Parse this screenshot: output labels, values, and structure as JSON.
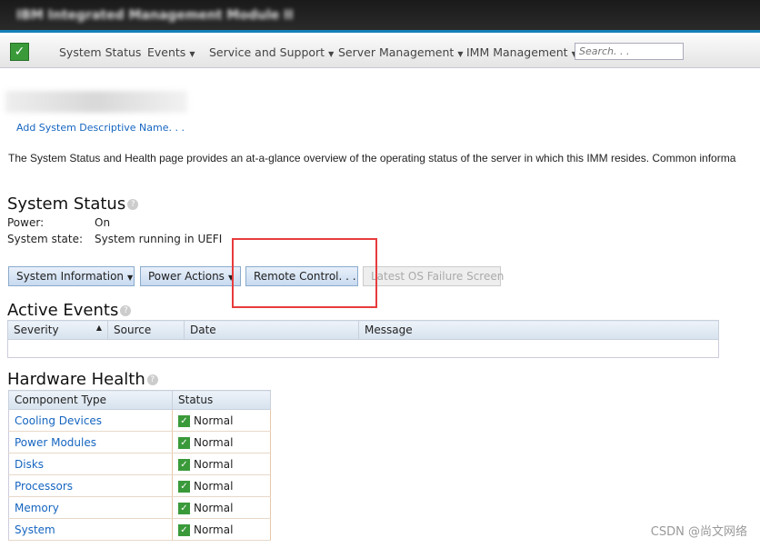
{
  "window": {
    "title": "IBM Integrated Management Module II"
  },
  "nav": {
    "items": [
      {
        "label": "System Status",
        "dropdown": false
      },
      {
        "label": "Events",
        "dropdown": true
      },
      {
        "label": "Service and Support",
        "dropdown": true
      },
      {
        "label": "Server Management",
        "dropdown": true
      },
      {
        "label": "IMM Management",
        "dropdown": true
      }
    ],
    "search_placeholder": "Search. . ."
  },
  "page": {
    "add_name_link": "Add System Descriptive Name. . .",
    "intro": "The System Status and Health page provides an at-a-glance overview of the operating status of the server in which this IMM resides. Common informa"
  },
  "system_status": {
    "title": "System Status",
    "power_label": "Power:",
    "power_value": "On",
    "state_label": "System state:",
    "state_value": "System running in UEFI"
  },
  "actions": {
    "system_information": "System Information",
    "power_actions": "Power Actions",
    "remote_control": "Remote Control. . .",
    "os_failure": "Latest OS Failure Screen"
  },
  "active_events": {
    "title": "Active Events",
    "columns": [
      "Severity",
      "Source",
      "Date",
      "Message"
    ]
  },
  "hardware_health": {
    "title": "Hardware Health",
    "columns": [
      "Component Type",
      "Status"
    ],
    "rows": [
      {
        "component": "Cooling Devices",
        "status": "Normal"
      },
      {
        "component": "Power Modules",
        "status": "Normal"
      },
      {
        "component": "Disks",
        "status": "Normal"
      },
      {
        "component": "Processors",
        "status": "Normal"
      },
      {
        "component": "Memory",
        "status": "Normal"
      },
      {
        "component": "System",
        "status": "Normal"
      }
    ]
  },
  "watermark": "CSDN @尚文网络",
  "colors": {
    "accent": "#1680b8",
    "link": "#1565c0",
    "ok": "#3a9a3a",
    "highlight": "#e83c3c"
  }
}
